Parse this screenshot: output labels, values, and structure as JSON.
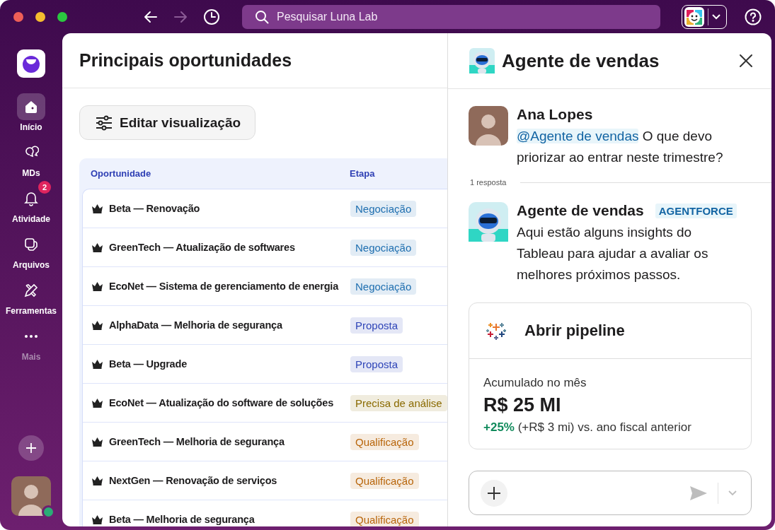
{
  "topbar": {
    "nav": [
      {
        "kind": "back",
        "disabled": false
      },
      {
        "kind": "forward",
        "disabled": true
      },
      {
        "kind": "history",
        "disabled": false
      }
    ],
    "search": {
      "placeholder": "Pesquisar Luna Lab"
    }
  },
  "sidebar": {
    "items": [
      {
        "kind": "home",
        "label": "Início",
        "selected": true
      },
      {
        "kind": "dms",
        "label": "MDs",
        "selected": false
      },
      {
        "kind": "activity",
        "label": "Atividade",
        "selected": false,
        "badge": "2"
      },
      {
        "kind": "files",
        "label": "Arquivos",
        "selected": false
      },
      {
        "kind": "tools",
        "label": "Ferramentas",
        "selected": false
      },
      {
        "kind": "more",
        "label": "Mais",
        "selected": false
      }
    ]
  },
  "main": {
    "title": "Principais oportunidades",
    "edit_button": "Editar visualização",
    "table": {
      "columns": [
        "Oportunidade",
        "Etapa"
      ],
      "rows": [
        {
          "name": "Beta — Renovação",
          "stage": "Negociação",
          "color": "#1f6fb0"
        },
        {
          "name": "GreenTech — Atualização de softwares",
          "stage": "Negociação",
          "color": "#1f6fb0"
        },
        {
          "name": "EcoNet — Sistema de gerenciamento de energia",
          "stage": "Negociação",
          "color": "#1f6fb0"
        },
        {
          "name": "AlphaData — Melhoria de segurança",
          "stage": "Proposta",
          "color": "#2f45b8"
        },
        {
          "name": "Beta — Upgrade",
          "stage": "Proposta",
          "color": "#2f45b8"
        },
        {
          "name": "EcoNet — Atualização do software de soluções",
          "stage": "Precisa de análise",
          "color": "#8a6a00"
        },
        {
          "name": "GreenTech — Melhoria de segurança",
          "stage": "Qualificação",
          "color": "#b8650a"
        },
        {
          "name": "NextGen — Renovação de serviços",
          "stage": "Qualificação",
          "color": "#b8650a"
        },
        {
          "name": "Beta — Melhoria de segurança",
          "stage": "Qualificação",
          "color": "#b8650a"
        }
      ]
    }
  },
  "panel": {
    "title": "Agente de vendas",
    "question": {
      "author": "Ana Lopes",
      "mention": "@Agente de vendas",
      "text": "O que devo priorizar ao entrar neste trimestre?"
    },
    "replies": "1 resposta",
    "answer": {
      "author": "Agente de vendas",
      "tag": "AGENTFORCE",
      "text": "Aqui estão alguns insights do Tableau para ajudar a avaliar os melhores próximos passos."
    },
    "card": {
      "title": "Abrir pipeline",
      "metric_label": "Acumulado no mês",
      "metric_value": "R$ 25 MI",
      "change": "+25%",
      "change_text": "(+R$ 3 mi) vs. ano fiscal anterior"
    }
  }
}
